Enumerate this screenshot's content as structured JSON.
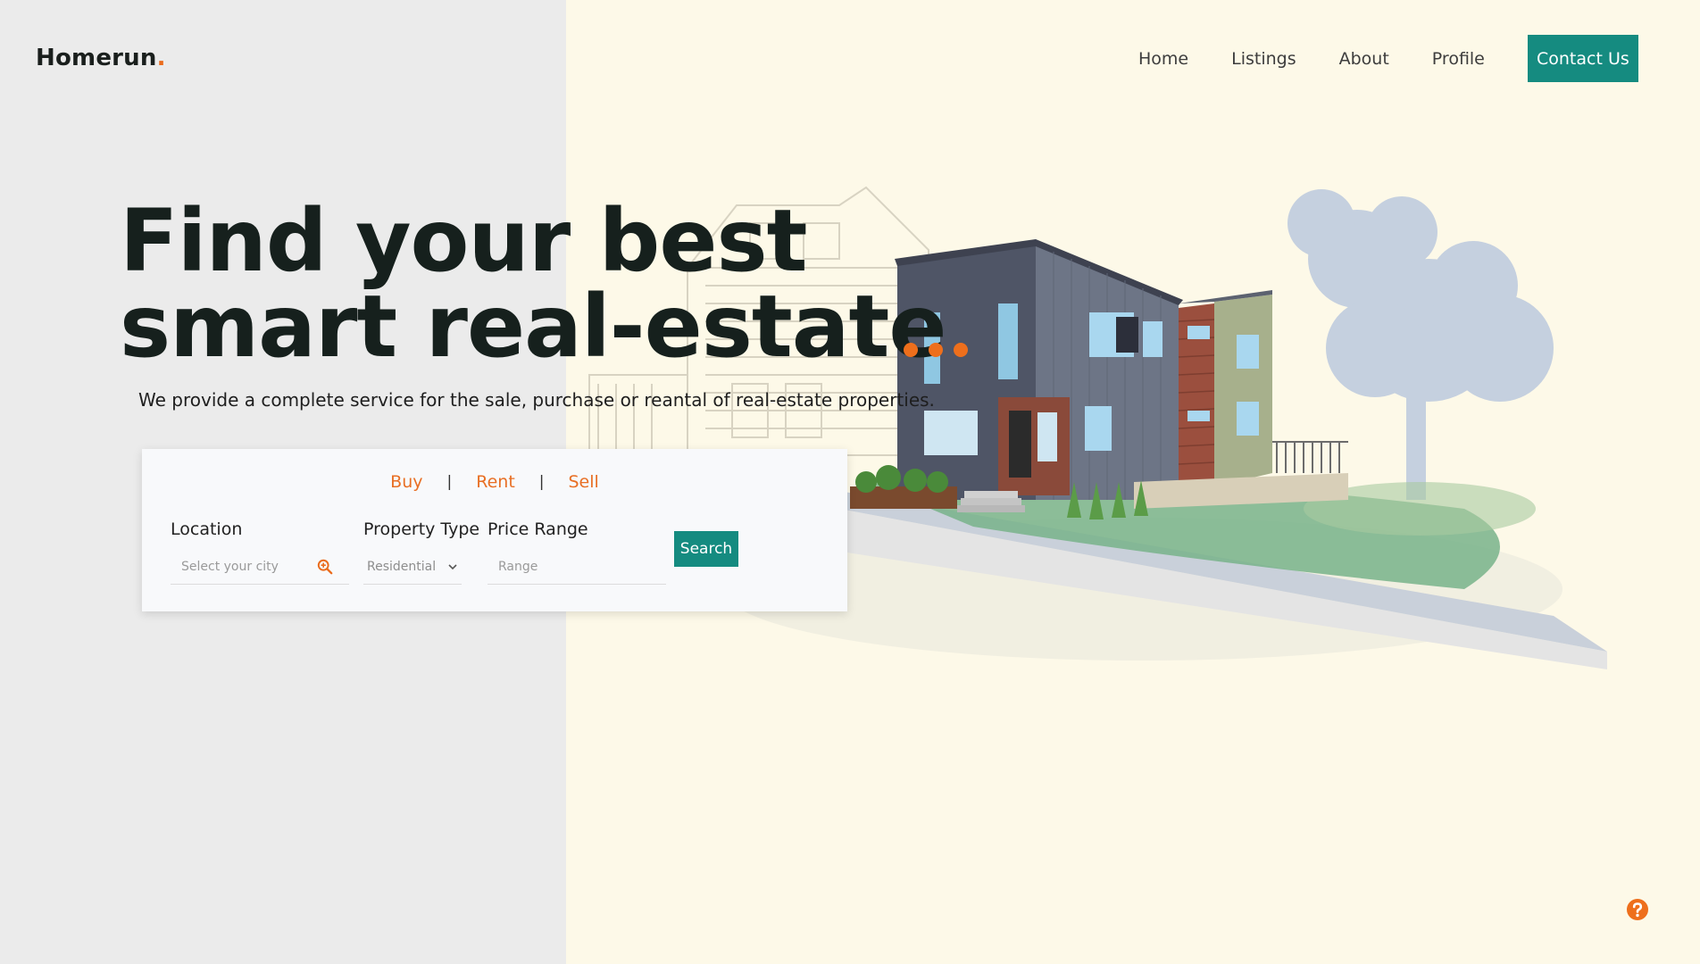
{
  "brand": {
    "name": "Homerun",
    "dot": "."
  },
  "nav": {
    "items": [
      {
        "label": "Home"
      },
      {
        "label": "Listings"
      },
      {
        "label": "About"
      },
      {
        "label": "Profile"
      }
    ],
    "contact_label": "Contact Us"
  },
  "hero": {
    "title_line1": "Find your best",
    "title_line2": "smart real-estate",
    "subtitle": "We provide a complete service for the sale, purchase or reantal of real-estate properties."
  },
  "search": {
    "tabs": [
      {
        "label": "Buy"
      },
      {
        "label": "Rent"
      },
      {
        "label": "Sell"
      }
    ],
    "separator": "|",
    "location": {
      "label": "Location",
      "placeholder": "Select your city"
    },
    "property_type": {
      "label": "Property Type",
      "value": "Residential"
    },
    "price_range": {
      "label": "Price Range",
      "placeholder": "Range"
    },
    "button_label": "Search"
  },
  "colors": {
    "accent": "#158b80",
    "highlight": "#ee6f1c",
    "left_bg": "#ebebeb",
    "right_bg": "#fdf9e8"
  },
  "icons": [
    "search-zoom-icon",
    "chevron-down-icon",
    "help-icon"
  ]
}
